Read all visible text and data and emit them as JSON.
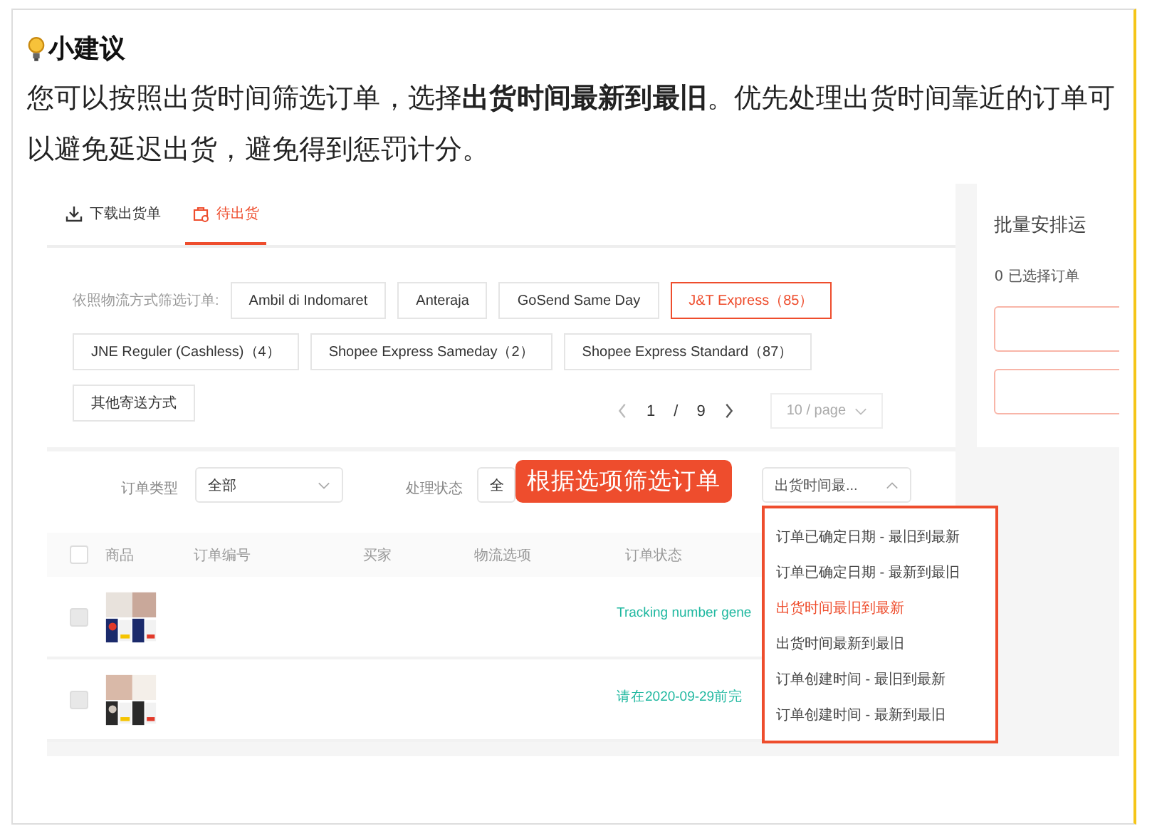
{
  "tip": {
    "title": "小建议",
    "text": "您可以按照出货时间筛选订单，选择**出货时间最新到最旧**。优先处理出货时间靠近的订单可以避免延迟出货，避免得到惩罚计分。"
  },
  "screenshot": {
    "tabs": [
      {
        "label": "下载出货单",
        "kind": "download",
        "selected": false
      },
      {
        "label": "待出货",
        "kind": "bag",
        "selected": true
      }
    ],
    "filter_label": "依照物流方式筛选订单:",
    "carriers": [
      {
        "label": "Ambil di Indomaret",
        "selected": false
      },
      {
        "label": "Anteraja",
        "selected": false
      },
      {
        "label": "GoSend Same Day",
        "selected": false
      },
      {
        "label": "J&T Express（85）",
        "selected": true
      },
      {
        "label": "JNE Reguler (Cashless)（4）",
        "selected": false
      },
      {
        "label": "Shopee Express Sameday（2）",
        "selected": false
      },
      {
        "label": "Shopee Express Standard（87）",
        "selected": false
      },
      {
        "label": "其他寄送方式",
        "selected": false
      }
    ],
    "pagination": {
      "page": "1",
      "separator": "/",
      "total": "9",
      "page_size": "10 / page"
    },
    "order_type": {
      "label": "订单类型",
      "value": "全部"
    },
    "status_filter": {
      "label": "处理状态",
      "value": "全"
    },
    "callout": "根据选项筛选订单",
    "sort": {
      "value": "出货时间最...",
      "expanded": true,
      "options": [
        {
          "label": "订单已确定日期 - 最旧到最新",
          "selected": false
        },
        {
          "label": "订单已确定日期 - 最新到最旧",
          "selected": false
        },
        {
          "label": "出货时间最旧到最新",
          "selected": true
        },
        {
          "label": "出货时间最新到最旧",
          "selected": false
        },
        {
          "label": "订单创建时间 - 最旧到最新",
          "selected": false
        },
        {
          "label": "订单创建时间 - 最新到最旧",
          "selected": false
        }
      ]
    },
    "table": {
      "select_all_checked": false,
      "columns": [
        "商品",
        "订单编号",
        "买家",
        "物流选项",
        "订单状态"
      ],
      "rows": [
        {
          "disabled": true,
          "status": "Tracking number gene"
        },
        {
          "disabled": true,
          "status": "请在2020-09-29前完"
        }
      ]
    },
    "side_panel": {
      "title": "批量安排运",
      "selected_count": "0 已选择订单"
    }
  }
}
